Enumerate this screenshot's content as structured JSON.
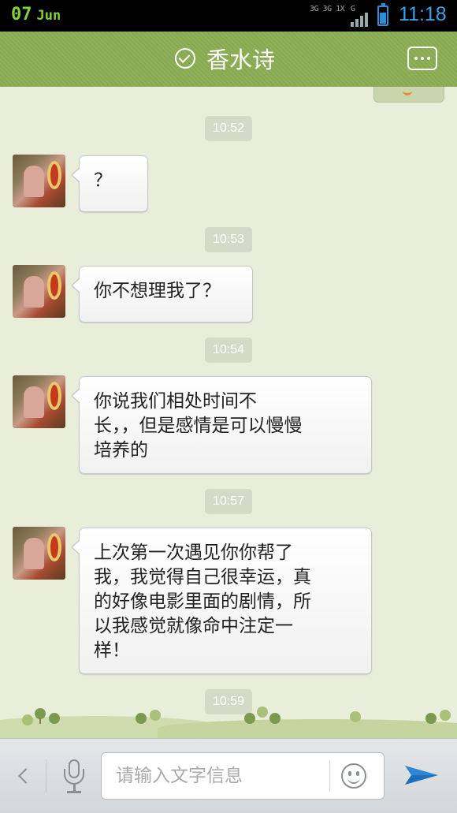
{
  "status_bar": {
    "date_day": "07",
    "date_month": "Jun",
    "network_top": "3G 3G 1X",
    "network_g": "G",
    "time": "11:18"
  },
  "header": {
    "title": "香水诗",
    "verified_icon": "check-circle-icon",
    "more_icon": "more-dots-icon"
  },
  "messages": [
    {
      "time": "10:52",
      "lines": [
        "？"
      ]
    },
    {
      "time": "10:53",
      "lines": [
        "你不想理我了？"
      ]
    },
    {
      "time": "10:54",
      "lines": [
        "你说我们相处时间不",
        "长，，但是感情是可以慢慢",
        "培养的"
      ]
    },
    {
      "time": "10:57",
      "lines": [
        "上次第一次遇见你你帮了",
        "我，我觉得自己很幸运，真",
        "的好像电影里面的剧情，所",
        "以我感觉就像命中注定一",
        "样！"
      ]
    },
    {
      "time": "10:59",
      "lines": []
    }
  ],
  "input_bar": {
    "placeholder": "请输入文字信息",
    "mic_icon": "microphone-icon",
    "emoji_icon": "smiley-icon",
    "send_icon": "send-arrow-icon",
    "back_icon": "chevron-left-icon"
  },
  "colors": {
    "header_green": "#8fb159",
    "chat_bg": "#e9eedb",
    "time_color": "#36a3e8",
    "date_color": "#7ed23a"
  }
}
